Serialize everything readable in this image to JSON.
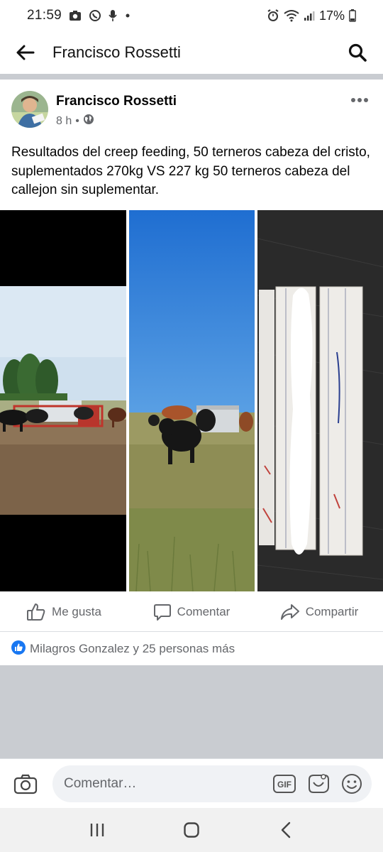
{
  "status_bar": {
    "time": "21:59",
    "battery": "17%",
    "icons_left": [
      "camera-icon",
      "whatsapp-icon",
      "mic-icon",
      "dot-icon"
    ],
    "icons_right": [
      "alarm-icon",
      "wifi-icon",
      "signal-icon",
      "battery-icon"
    ]
  },
  "header": {
    "title": "Francisco Rossetti",
    "back_icon": "arrow-left-icon",
    "search_icon": "search-icon"
  },
  "post": {
    "author": "Francisco Rossetti",
    "time": "8 h",
    "separator": "•",
    "privacy_icon": "globe-icon",
    "text": "Resultados del creep feeding, 50 terneros cabeza del cristo, suplementados 270kg VS 227 kg 50 terneros cabeza del callejon sin suplementar.",
    "photos": [
      {
        "description_icon": "photo-cattle-feeder"
      },
      {
        "description_icon": "photo-cattle-field"
      },
      {
        "description_icon": "photo-weigh-tickets"
      }
    ]
  },
  "actions": {
    "like": "Me gusta",
    "comment": "Comentar",
    "share": "Compartir"
  },
  "reactions": {
    "text": "Milagros Gonzalez y 25 personas más"
  },
  "composer": {
    "placeholder": "Comentar…",
    "gif_label": "GIF"
  },
  "colors": {
    "accent": "#1877f2",
    "secondary_text": "#65676b",
    "divider": "#c9ccd1"
  }
}
